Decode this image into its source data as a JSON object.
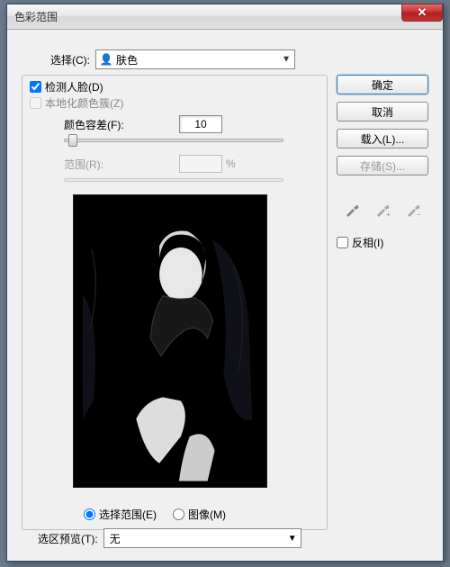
{
  "window": {
    "title": "色彩范围",
    "close": "✕"
  },
  "select": {
    "label": "选择(C):",
    "icon": "👤",
    "value": "肤色"
  },
  "checkboxes": {
    "detect_faces": {
      "label": "检测人脸(D)",
      "checked": true
    },
    "localized": {
      "label": "本地化颜色簇(Z)",
      "checked": false
    }
  },
  "fuzziness": {
    "label": "颜色容差(F):",
    "value": "10"
  },
  "range": {
    "label": "范围(R):",
    "pct": "%"
  },
  "radios": {
    "selection": "选择范围(E)",
    "image": "图像(M)"
  },
  "buttons": {
    "ok": "确定",
    "cancel": "取消",
    "load": "载入(L)...",
    "save": "存储(S)..."
  },
  "invert": {
    "label": "反相(I)"
  },
  "preview_sel": {
    "label": "选区预览(T):",
    "value": "无"
  }
}
